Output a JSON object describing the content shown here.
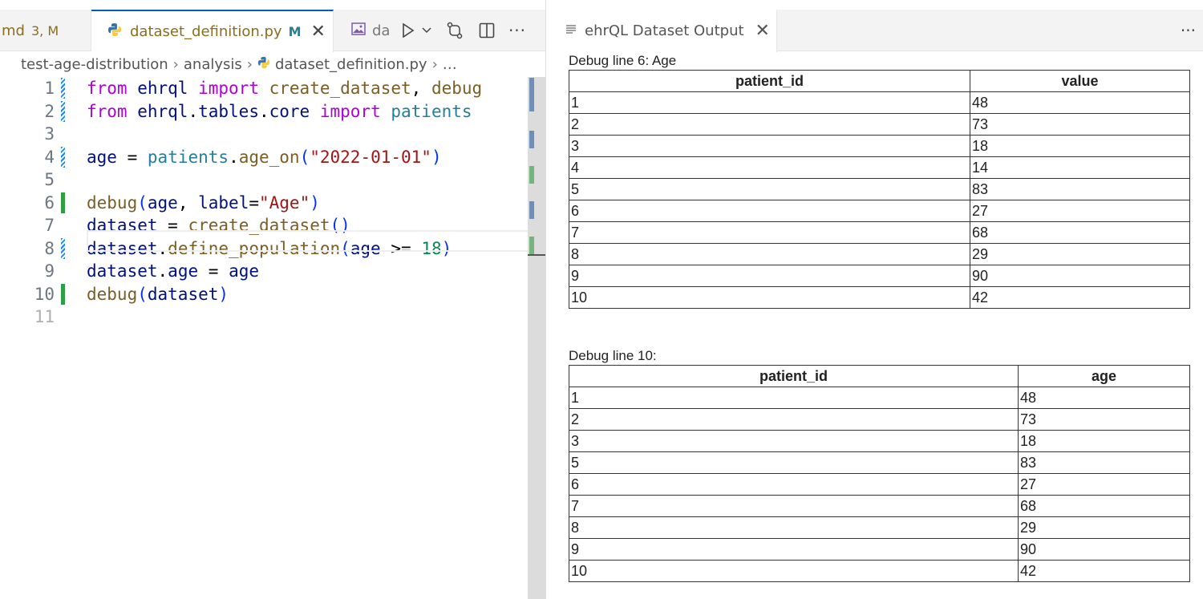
{
  "left_tabs": {
    "md_tab": {
      "label": "md",
      "dirty": "3, M"
    },
    "dataset_tab": {
      "label": "dataset_definition.py",
      "modified": "M",
      "close": "✕"
    },
    "da_tab": {
      "label": "da"
    }
  },
  "breadcrumb": [
    "test-age-distribution",
    "analysis",
    "dataset_definition.py",
    "…"
  ],
  "editor": {
    "line_numbers": [
      "1",
      "2",
      "3",
      "4",
      "5",
      "6",
      "7",
      "8",
      "9",
      "10",
      "11"
    ]
  },
  "right_tabs": {
    "output_tab": {
      "label": "ehrQL Dataset Output",
      "close": "✕"
    }
  },
  "output": {
    "block1": {
      "title": "Debug line 6: Age",
      "headers": [
        "patient_id",
        "value"
      ],
      "rows": [
        [
          "1",
          "48"
        ],
        [
          "2",
          "73"
        ],
        [
          "3",
          "18"
        ],
        [
          "4",
          "14"
        ],
        [
          "5",
          "83"
        ],
        [
          "6",
          "27"
        ],
        [
          "7",
          "68"
        ],
        [
          "8",
          "29"
        ],
        [
          "9",
          "90"
        ],
        [
          "10",
          "42"
        ]
      ]
    },
    "block2": {
      "title": "Debug line 10:",
      "headers": [
        "patient_id",
        "age"
      ],
      "rows": [
        [
          "1",
          "48"
        ],
        [
          "2",
          "73"
        ],
        [
          "3",
          "18"
        ],
        [
          "5",
          "83"
        ],
        [
          "6",
          "27"
        ],
        [
          "7",
          "68"
        ],
        [
          "8",
          "29"
        ],
        [
          "9",
          "90"
        ],
        [
          "10",
          "42"
        ]
      ]
    }
  },
  "icons": {
    "python": "python-file-icon",
    "image": "image-preview-icon",
    "run": "run-icon",
    "compare": "compare-changes-icon",
    "split": "split-editor-icon",
    "more": "more-actions-icon",
    "output_file": "output-lines-icon"
  },
  "colors": {
    "tab_modified": "#8a6d1e",
    "keyword": "#af00db",
    "function": "#795e26",
    "variable": "#001080",
    "module": "#267f99",
    "string": "#a31515",
    "number": "#098658",
    "gutter_added": "#2ea043",
    "gutter_modified": "#1a85ff"
  }
}
